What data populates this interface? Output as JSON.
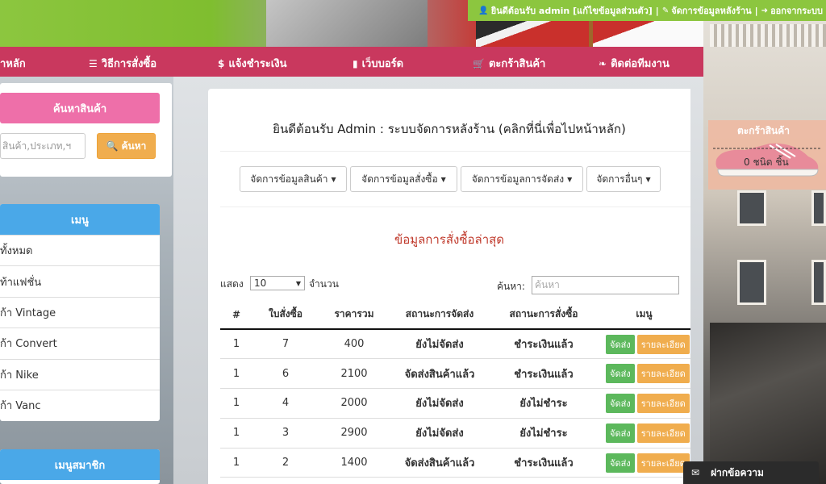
{
  "top_bar": {
    "welcome": "ยินดีต้อนรับ admin [แก้ไขข้อมูลส่วนตัว]",
    "backend": "จัดการข้อมูลหลังร้าน",
    "logout": "ออกจากระบบ",
    "sep": "|"
  },
  "nav": {
    "home": "าหลัก",
    "howto": "วิธีการสั่งซื้อ",
    "payment": "แจ้งชำระเงิน",
    "board": "เว็บบอร์ด",
    "cart": "ตะกร้าสินค้า",
    "contact": "ติดต่อทีมงาน"
  },
  "sidebar": {
    "search_title": "ค้นหาสินค้า",
    "search_placeholder": "สินค้า,ประเภท,ฯ",
    "search_button": "ค้นหา",
    "menu_title": "เมนู",
    "menu_items": [
      {
        "label": "ทั้งหมด"
      },
      {
        "label": "ท้าแฟชั่น"
      },
      {
        "label": "ก้า Vintage"
      },
      {
        "label": "ก้า Convert"
      },
      {
        "label": "ก้า Nike"
      },
      {
        "label": "ก้า Vanc"
      }
    ],
    "member_title": "เมนูสมาชิก"
  },
  "main": {
    "welcome": "ยินดีต้อนรับ Admin : ระบบจัดการหลังร้าน (คลิกที่นี่เพื่อไปหน้าหลัก)",
    "menus": [
      {
        "label": "จัดการข้อมูลสินค้า"
      },
      {
        "label": "จัดการข้อมูลสั่งซื้อ"
      },
      {
        "label": "จัดการข้อมูลการจัดส่ง"
      },
      {
        "label": "จัดการอื่นๆ"
      }
    ],
    "section_title": "ข้อมูลการสั่งซื้อล่าสุด",
    "show_label": "แสดง",
    "show_value": "10",
    "show_unit": "จำนวน",
    "search_label": "ค้นหา:",
    "search_placeholder": "ค้นหา"
  },
  "table": {
    "headers": [
      "#",
      "ใบสั่งซื้อ",
      "ราคารวม",
      "สถานะการจัดส่ง",
      "สถานะการสั่งซื้อ",
      "เมนู"
    ],
    "ship_button": "จัดส่ง",
    "detail_button": "รายละเอียด",
    "rows": [
      {
        "num": "1",
        "order": "7",
        "total": "400",
        "ship_status": "ยังไม่จัดส่ง",
        "ship_ok": false,
        "order_status": "ชำระเงินแล้ว",
        "paid": true
      },
      {
        "num": "1",
        "order": "6",
        "total": "2100",
        "ship_status": "จัดส่งสินค้าแล้ว",
        "ship_ok": true,
        "order_status": "ชำระเงินแล้ว",
        "paid": true
      },
      {
        "num": "1",
        "order": "4",
        "total": "2000",
        "ship_status": "ยังไม่จัดส่ง",
        "ship_ok": false,
        "order_status": "ยังไม่ชำระ",
        "paid": false
      },
      {
        "num": "1",
        "order": "3",
        "total": "2900",
        "ship_status": "ยังไม่จัดส่ง",
        "ship_ok": false,
        "order_status": "ยังไม่ชำระ",
        "paid": false
      },
      {
        "num": "1",
        "order": "2",
        "total": "1400",
        "ship_status": "จัดส่งสินค้าแล้ว",
        "ship_ok": true,
        "order_status": "ชำระเงินแล้ว",
        "paid": true
      }
    ]
  },
  "cart_widget": {
    "title": "ตะกร้าสินค้า",
    "count": "0 ชนิด ชิ้น"
  },
  "chat": {
    "label": "ฝากข้อความ"
  },
  "colors": {
    "green_bar": "#8cc63f",
    "nav_pink": "#c9385e",
    "search_pink": "#ee6fa9",
    "menu_blue": "#4aa8e8",
    "status_red": "#c0392b",
    "status_green": "#3c8d3c"
  }
}
